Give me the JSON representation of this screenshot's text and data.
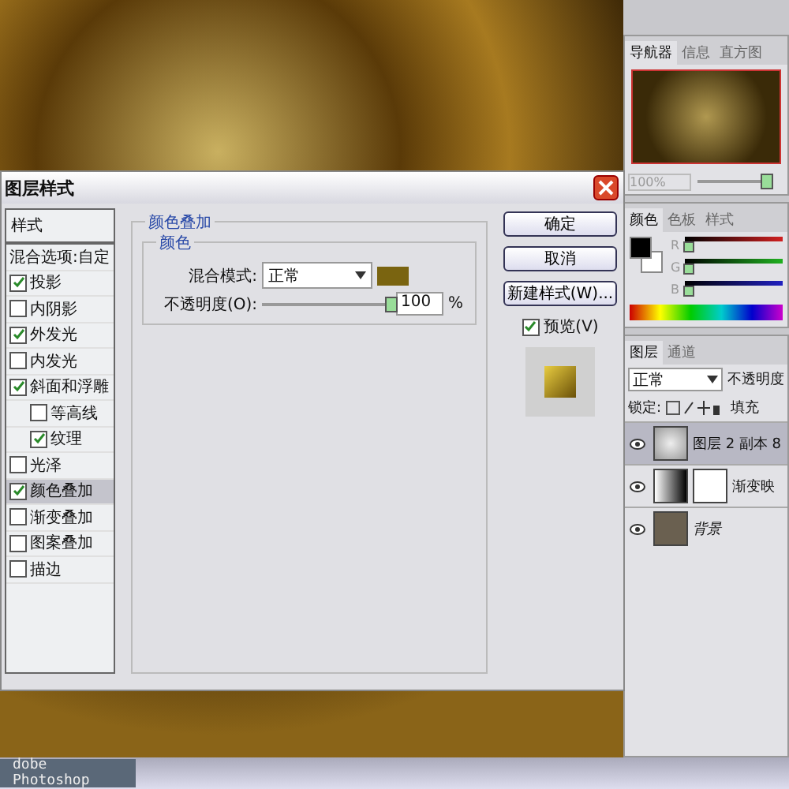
{
  "dialog": {
    "title": "图层样式",
    "styles_header": "样式",
    "blend_options": "混合选项:自定",
    "styles": [
      {
        "label": "投影",
        "checked": true,
        "selected": false
      },
      {
        "label": "内阴影",
        "checked": false,
        "selected": false
      },
      {
        "label": "外发光",
        "checked": true,
        "selected": false
      },
      {
        "label": "内发光",
        "checked": false,
        "selected": false
      },
      {
        "label": "斜面和浮雕",
        "checked": true,
        "selected": false,
        "children": [
          {
            "label": "等高线",
            "checked": false,
            "selected": false
          },
          {
            "label": "纹理",
            "checked": true,
            "selected": false
          }
        ]
      },
      {
        "label": "光泽",
        "checked": false,
        "selected": false
      },
      {
        "label": "颜色叠加",
        "checked": true,
        "selected": true
      },
      {
        "label": "渐变叠加",
        "checked": false,
        "selected": false
      },
      {
        "label": "图案叠加",
        "checked": false,
        "selected": false
      },
      {
        "label": "描边",
        "checked": false,
        "selected": false
      }
    ],
    "group_title": "颜色叠加",
    "subgroup_title": "颜色",
    "blend_mode_label": "混合模式:",
    "blend_mode": "正常",
    "opacity_label": "不透明度(O):",
    "opacity": {
      "level": 1.0,
      "value": "100",
      "unit": "%"
    },
    "buttons": [
      "确定",
      "取消",
      "新建样式(W)..."
    ],
    "preview": {
      "label": "预览(V)",
      "checked": true
    }
  },
  "navigator": {
    "tabs": [
      {
        "label": "导航器",
        "selected": true
      },
      {
        "label": "信息",
        "selected": false
      },
      {
        "label": "直方图",
        "selected": false
      }
    ],
    "zoom": "100%",
    "zoom_slider": {
      "level": 0.85
    }
  },
  "color_panel": {
    "tabs": [
      {
        "label": "颜色",
        "selected": true
      },
      {
        "label": "色板",
        "selected": false
      },
      {
        "label": "样式",
        "selected": false
      }
    ],
    "channels": [
      {
        "name": "R",
        "level": 0.0
      },
      {
        "name": "G",
        "level": 0.0
      },
      {
        "name": "B",
        "level": 0.0
      }
    ]
  },
  "layers_panel": {
    "tabs": [
      {
        "label": "图层",
        "selected": true
      },
      {
        "label": "通道",
        "selected": false
      }
    ],
    "blend_mode": "正常",
    "opacity_label": "不透明度",
    "lock_label": "锁定:",
    "fill_label": "填充",
    "layers": [
      {
        "name": "图层 2 副本 8",
        "kind": "pattern",
        "selected": true,
        "visible": true
      },
      {
        "name": "渐变映",
        "kind": "adjustment",
        "selected": false,
        "visible": true
      },
      {
        "name": "背景",
        "kind": "photo",
        "selected": false,
        "visible": true
      }
    ]
  },
  "taskbar": {
    "items": [
      {
        "label": "dobe Photoshop",
        "selected": true
      }
    ]
  }
}
